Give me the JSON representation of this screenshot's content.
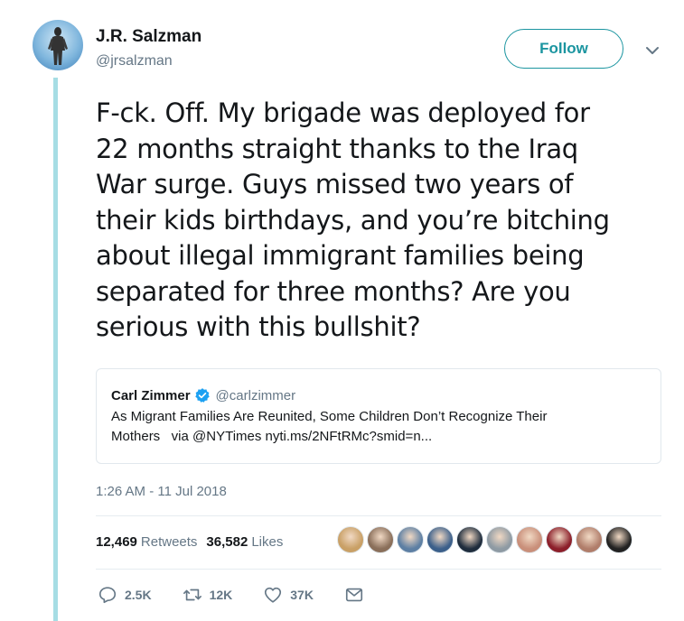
{
  "author": {
    "name": "J.R. Salzman",
    "handle": "@jrsalzman"
  },
  "follow_label": "Follow",
  "tweet_text": "F-ck. Off. My brigade was deployed for\n22 months straight thanks to the Iraq\nWar surge. Guys missed two years of\ntheir kids birthdays, and you’re bitching\nabout illegal immigrant families being\nseparated for three months? Are you\nserious with this bullshit?",
  "quoted": {
    "name": "Carl Zimmer",
    "handle": "@carlzimmer",
    "text": "As Migrant Families Are Reunited, Some Children Don’t Recognize Their\nMothers   via @NYTimes nyti.ms/2NFtRMc?smid=n..."
  },
  "timestamp": "1:26 AM - 11 Jul 2018",
  "stats": {
    "retweets_count": "12,469",
    "retweets_label": "Retweets",
    "likes_count": "36,582",
    "likes_label": "Likes"
  },
  "actions": {
    "replies": "2.5K",
    "retweets": "12K",
    "likes": "37K"
  },
  "colors": {
    "accent": "#1b95a0",
    "thread": "#a6dde4",
    "muted": "#657786",
    "verified": "#1da1f2"
  },
  "liker_avatars": [
    {
      "color": "#c9a066"
    },
    {
      "color": "#8a6f5a"
    },
    {
      "color": "#5d7fa3"
    },
    {
      "color": "#3b5f8a"
    },
    {
      "color": "#1f2d3d"
    },
    {
      "color": "#8e9aa3"
    },
    {
      "color": "#c98f7a"
    },
    {
      "color": "#8c1f2a"
    },
    {
      "color": "#b07d6a"
    },
    {
      "color": "#222222"
    }
  ]
}
